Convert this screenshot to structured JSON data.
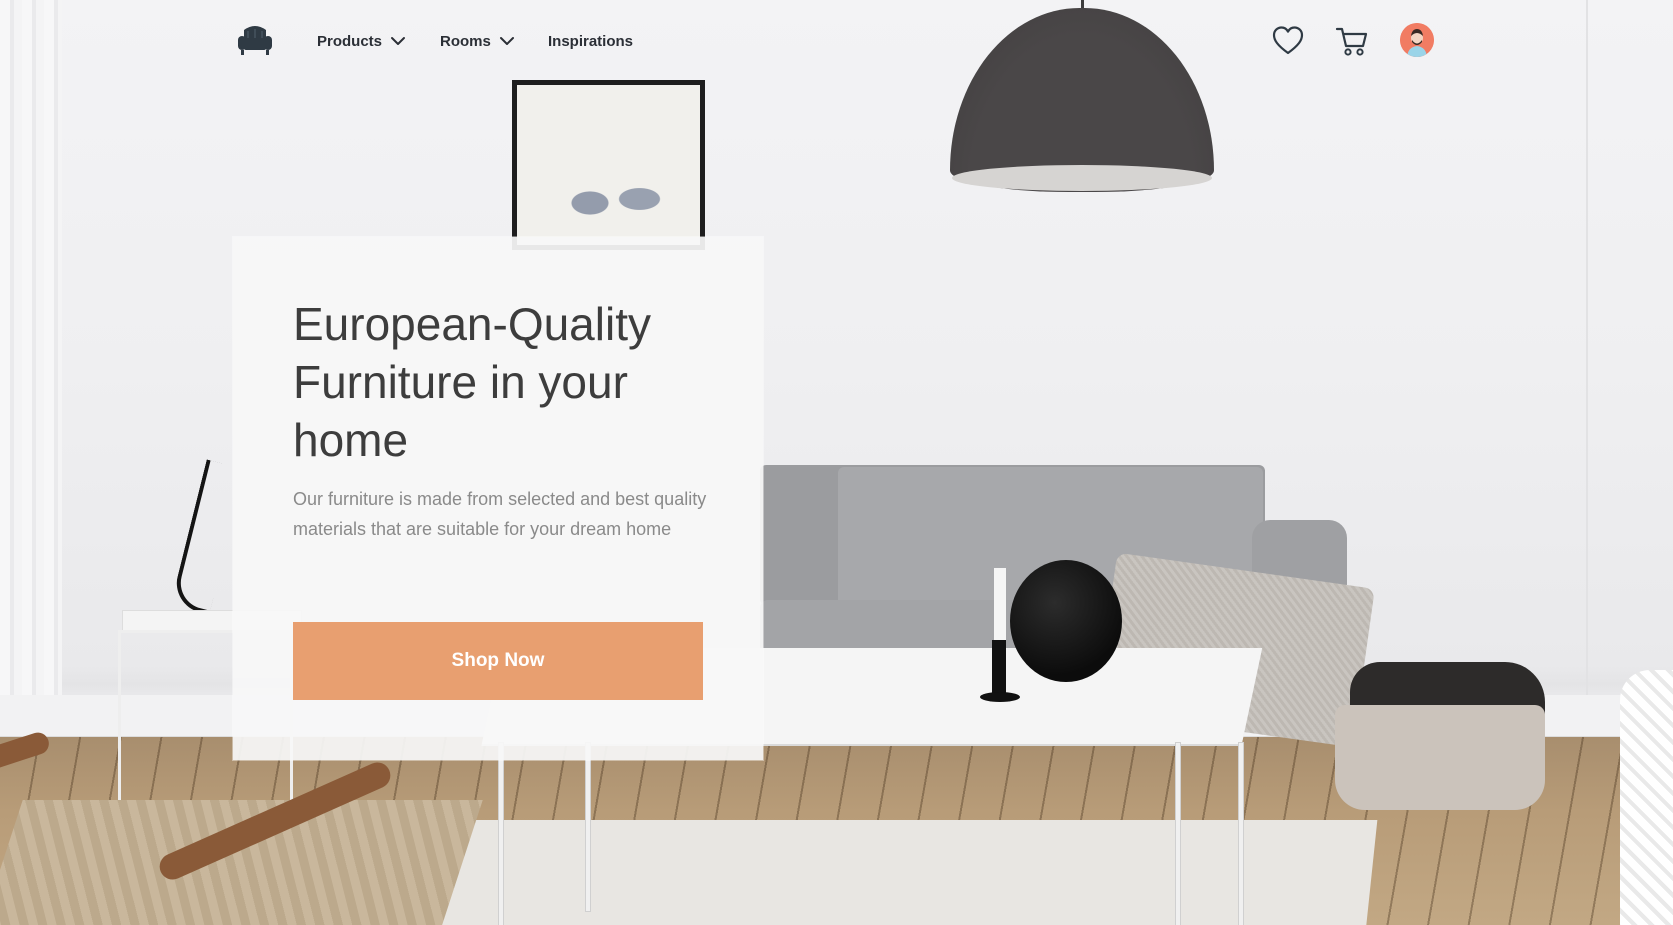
{
  "nav": {
    "logo_icon": "armchair-icon",
    "items": [
      {
        "label": "Products",
        "icon": "chevron-down-icon"
      },
      {
        "label": "Rooms",
        "icon": "chevron-down-icon"
      },
      {
        "label": "Inspirations"
      }
    ],
    "actions": [
      "heart-icon",
      "cart-icon",
      "avatar"
    ]
  },
  "hero": {
    "title": "European-Quality Furniture in your home",
    "description": "Our furniture is made from selected and best quality materials that are suitable for your dream home",
    "cta_label": "Shop Now"
  },
  "colors": {
    "accent": "#e89f70",
    "text_dark": "#3d3d3d",
    "text_muted": "#8a8a8a",
    "nav_text": "#2b2f36",
    "avatar_bg": "#f17c63"
  }
}
